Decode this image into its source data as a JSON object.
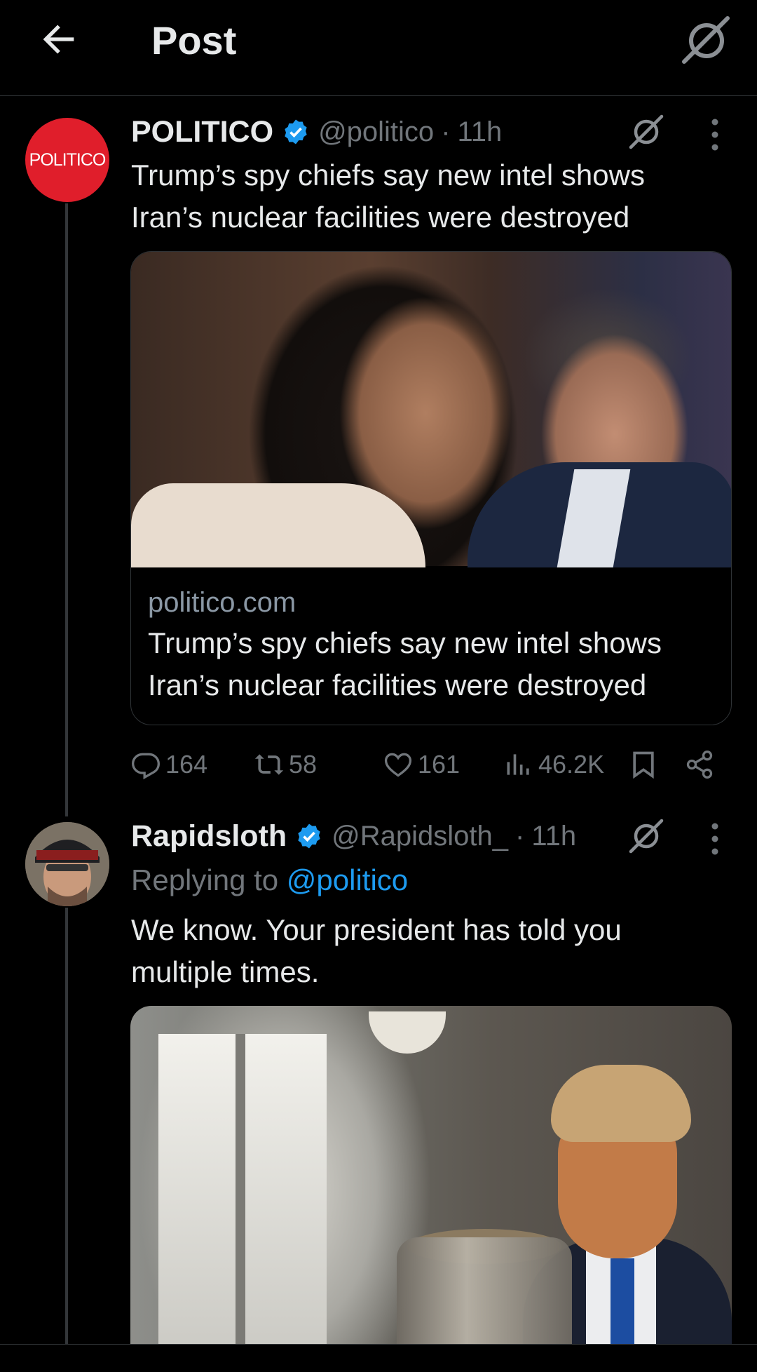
{
  "header": {
    "title": "Post",
    "back_icon": "arrow-left-icon",
    "grok_icon": "grok-icon"
  },
  "tweet": {
    "avatar_text": "POLITICO",
    "name": "POLITICO",
    "handle": "@politico",
    "separator": "·",
    "time": "11h",
    "text": "Trump’s spy chiefs say new intel shows Iran’s nuclear facilities were destroyed",
    "card": {
      "domain": "politico.com",
      "title": "Trump’s spy chiefs say new intel shows Iran’s nuclear facilities were destroyed"
    },
    "actions": {
      "replies": "164",
      "reposts": "58",
      "likes": "161",
      "views": "46.2K"
    }
  },
  "reply": {
    "name": "Rapidsloth",
    "handle": "@Rapidsloth_",
    "separator": "·",
    "time": "11h",
    "replying_prefix": "Replying to ",
    "replying_to": "@politico",
    "text": "We know. Your president has told you multiple times."
  },
  "colors": {
    "background": "#000000",
    "text": "#e7e9ea",
    "secondary": "#71767b",
    "accent": "#1d9bf0",
    "politico_red": "#e01e2b"
  }
}
